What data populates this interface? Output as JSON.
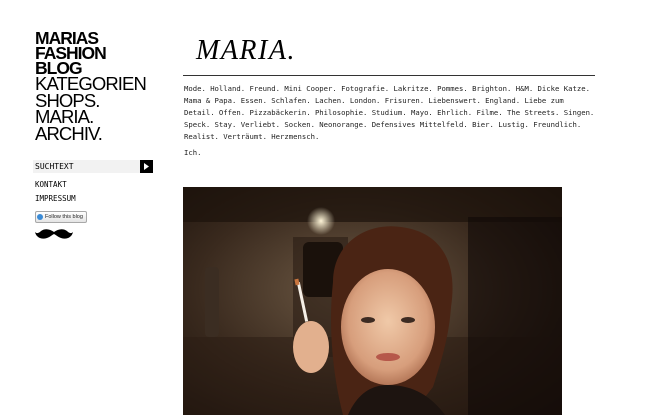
{
  "sidebar": {
    "brand": [
      "MARIAS",
      "FASHION",
      "BLOG"
    ],
    "nav": [
      "KATEGORIEN",
      "SHOPS.",
      "MARIA.",
      "ARCHIV."
    ],
    "search": {
      "placeholder": "SUCHTEXT"
    },
    "links": [
      "KONTAKT",
      "IMPRESSUM"
    ],
    "follow_label": "Follow this blog"
  },
  "main": {
    "title": "MARIA.",
    "about": "Mode. Holland. Freund. Mini Cooper. Fotografie. Lakritze. Pommes. Brighton. H&M. Dicke Katze. Mama & Papa. Essen. Schlafen. Lachen. London. Frisuren. Liebenswert. England. Liebe zum Detail. Offen. Pizzabäckerin. Philosophie. Studium. Mayo. Ehrlich. Filme. The Streets. Singen. Speck. Stay. Verliebt. Socken. Neonorange. Defensives Mittelfeld. Bier. Lustig. Freundlich. Realist. Verträumt. Herzmensch.",
    "signoff": "Ich."
  },
  "icons": {
    "search": "arrow-right-icon",
    "follow": "follow-icon",
    "logo": "mustache-icon"
  },
  "colors": {
    "text": "#000000",
    "search_bg": "#f2f2f2",
    "search_button": "#000000",
    "follow_accent": "#3b8bd6"
  }
}
